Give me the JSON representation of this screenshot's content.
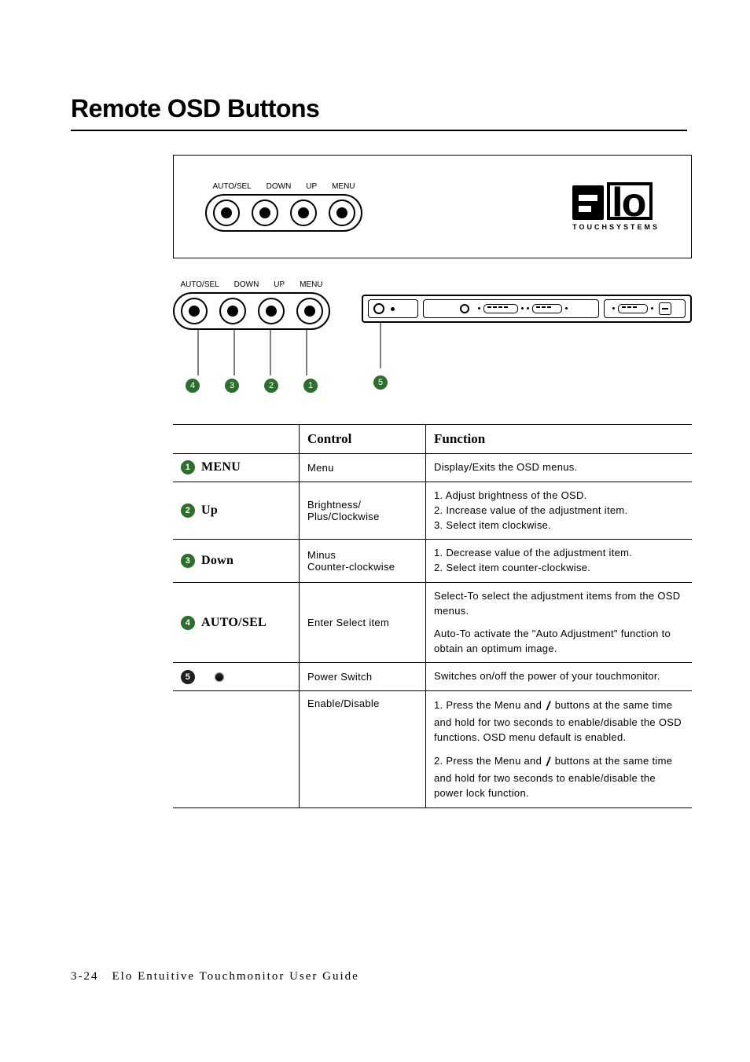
{
  "title": "Remote OSD Buttons",
  "remote_labels": [
    "AUTO/SEL",
    "DOWN",
    "UP",
    "MENU"
  ],
  "logo_sub": "TOUCHSYSTEMS",
  "badge": {
    "b1": "1",
    "b2": "2",
    "b3": "3",
    "b4": "4",
    "b5": "5"
  },
  "table": {
    "headers": {
      "control": "Control",
      "function": "Function"
    },
    "rows": {
      "menu": {
        "label": "MENU",
        "control": "Menu",
        "function": "Display/Exits the OSD menus."
      },
      "up": {
        "label": "Up",
        "control": "Brightness/\nPlus/Clockwise",
        "function": "1. Adjust brightness of the OSD.\n2. Increase value of the adjustment item.\n3. Select item clockwise."
      },
      "down": {
        "label": "Down",
        "control": "Minus\nCounter-clockwise",
        "function": "1. Decrease value of the adjustment item.\n2. Select item counter-clockwise."
      },
      "autosel": {
        "label": "AUTO/SEL",
        "control": "Enter Select item",
        "function_a": "Select-To select the adjustment items from the OSD menus.",
        "function_b": "Auto-To activate the \"Auto Adjustment\" function to obtain an optimum image."
      },
      "power": {
        "control": "Power Switch",
        "function": "Switches on/off the power of your touchmonitor."
      },
      "enable": {
        "control": "Enable/Disable",
        "function_a_pre": "1. Press the Menu and ",
        "function_a_post": " buttons at the same time and hold for two seconds to enable/disable the OSD functions. OSD menu default is enabled.",
        "function_b_pre": "2. Press the Menu and ",
        "function_b_post": " buttons at the same time and hold for two seconds to enable/disable the power lock function."
      }
    }
  },
  "footer": "3-24 Elo Entuitive Touchmonitor User Guide"
}
